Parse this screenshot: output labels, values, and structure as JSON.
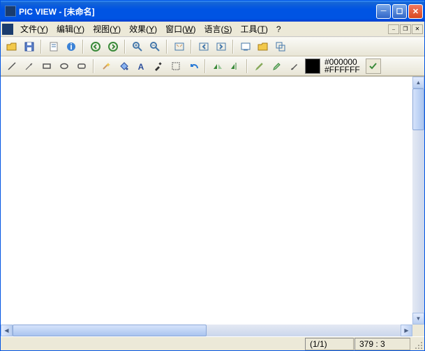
{
  "title": "PIC VIEW  -  [未命名]",
  "menu": {
    "file": {
      "label": "文件",
      "m": "Y"
    },
    "edit": {
      "label": "编辑",
      "m": "Y"
    },
    "view": {
      "label": "视图",
      "m": "Y"
    },
    "effect": {
      "label": "效果",
      "m": "Y"
    },
    "window": {
      "label": "窗口",
      "m": "W"
    },
    "lang": {
      "label": "语言",
      "m": "S"
    },
    "tools": {
      "label": "工具",
      "m": "T"
    },
    "help": {
      "label": "?"
    }
  },
  "colors": {
    "fg": "#000000",
    "bg": "#FFFFFF"
  },
  "status": {
    "page": "(1/1)",
    "coord": "379 : 3"
  }
}
